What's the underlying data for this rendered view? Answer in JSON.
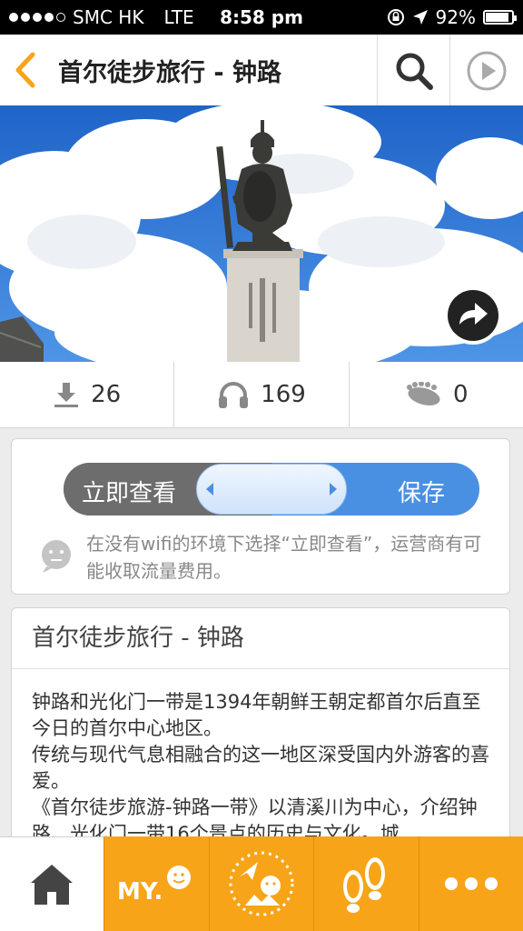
{
  "status_bar": {
    "carrier": "SMC HK",
    "network": "LTE",
    "time": "8:58 pm",
    "battery": "92%",
    "signal_bars": 4
  },
  "nav": {
    "title": "首尔徒步旅行 - 钟路",
    "back_icon": "chevron-left-icon",
    "search_icon": "search-icon",
    "play_icon": "play-circle-icon"
  },
  "hero": {
    "image": "statue-photo",
    "share_icon": "share-arrow-icon"
  },
  "stats": [
    {
      "icon": "download-icon",
      "value": "26"
    },
    {
      "icon": "headphones-icon",
      "value": "169"
    },
    {
      "icon": "footprints-icon",
      "value": "0"
    }
  ],
  "mode_toggle": {
    "left_label": "立即查看",
    "right_label": "保存"
  },
  "tip": {
    "icon": "face-icon",
    "text": "在没有wifi的环境下选择“立即查看”，运营商有可能收取流量费用。"
  },
  "description": {
    "title": "首尔徒步旅行 - 钟路",
    "paragraphs": [
      "钟路和光化门一带是1394年朝鲜王朝定都首尔后直至今日的首尔中心地区。",
      "传统与现代气息相融合的这一地区深受国内外游客的喜爱。",
      "《首尔徒步旅游-钟路一带》以清溪川为中心，介绍钟路、光化门一带16个景点的历史与文化。城"
    ]
  },
  "tab_bar": {
    "home_icon": "home-icon",
    "my_label": "MY.",
    "tabs": [
      "home-icon",
      "my-icon",
      "explore-icon",
      "footprints-icon",
      "more-icon"
    ]
  },
  "colors": {
    "accent_orange": "#f7a419",
    "toggle_blue": "#4a90e2",
    "toggle_gray": "#6d6d6d"
  }
}
